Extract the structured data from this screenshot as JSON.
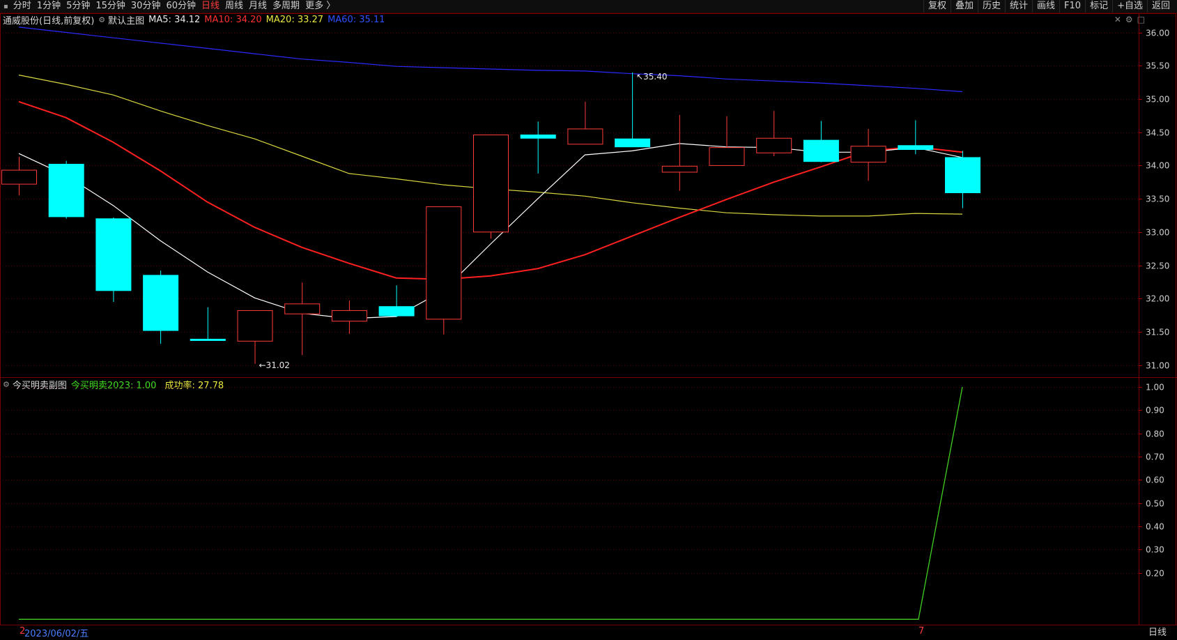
{
  "toolbar": {
    "left_items": [
      "分时",
      "1分钟",
      "5分钟",
      "15分钟",
      "30分钟",
      "60分钟",
      "日线",
      "周线",
      "月线",
      "多周期",
      "更多 〉"
    ],
    "active_item": "日线",
    "right_items": [
      "复权",
      "叠加",
      "历史",
      "统计",
      "画线",
      "F10",
      "标记",
      "+自选",
      "返回"
    ]
  },
  "main_legend": {
    "stock": "通威股份(日线,前复权)",
    "main_chart_name": "默认主图",
    "ma5": "MA5: 34.12",
    "ma10": "MA10: 34.20",
    "ma20": "MA20: 33.27",
    "ma60": "MA60: 35.11"
  },
  "sub_legend": {
    "name": "今买明卖副图",
    "indicator": "今买明卖2023: 1.00",
    "rate": "成功率: 27.78"
  },
  "footer": {
    "date_label": "2023/06/02/五",
    "left_marker": "2",
    "mid_marker": "7",
    "axis_button": "日线"
  },
  "colors": {
    "up": "#ff3b3b",
    "down": "#00ffff",
    "ma5": "#ffffff",
    "ma10": "#ff2020",
    "ma20": "#d8d840",
    "ma60": "#2a2aff",
    "indicator": "#40d020",
    "grid": "#7a0000",
    "axis_text": "#d0d0d0"
  },
  "chart_data": [
    {
      "type": "candlestick",
      "title": "通威股份(日线,前复权)",
      "ylim": [
        30.85,
        36.1
      ],
      "y_ticks": [
        31.0,
        31.5,
        32.0,
        32.5,
        33.0,
        33.5,
        34.0,
        34.5,
        35.0,
        35.5,
        36.0
      ],
      "candles": [
        {
          "open": 33.72,
          "close": 33.93,
          "high": 34.13,
          "low": 33.55
        },
        {
          "open": 34.02,
          "close": 33.23,
          "high": 34.07,
          "low": 33.2
        },
        {
          "open": 33.2,
          "close": 32.12,
          "high": 33.22,
          "low": 31.95
        },
        {
          "open": 32.35,
          "close": 31.52,
          "high": 32.42,
          "low": 31.32
        },
        {
          "open": 31.39,
          "close": 31.37,
          "high": 31.87,
          "low": 31.37
        },
        {
          "open": 31.36,
          "close": 31.82,
          "high": 31.82,
          "low": 31.02
        },
        {
          "open": 31.77,
          "close": 31.92,
          "high": 32.24,
          "low": 31.15
        },
        {
          "open": 31.66,
          "close": 31.82,
          "high": 31.97,
          "low": 31.47
        },
        {
          "open": 31.88,
          "close": 31.74,
          "high": 32.2,
          "low": 31.72
        },
        {
          "open": 31.69,
          "close": 33.38,
          "high": 33.38,
          "low": 31.46
        },
        {
          "open": 33.0,
          "close": 34.46,
          "high": 34.46,
          "low": 32.9
        },
        {
          "open": 34.46,
          "close": 34.41,
          "high": 34.66,
          "low": 33.88
        },
        {
          "open": 34.32,
          "close": 34.55,
          "high": 34.96,
          "low": 34.32
        },
        {
          "open": 34.4,
          "close": 34.28,
          "high": 35.4,
          "low": 34.28
        },
        {
          "open": 33.9,
          "close": 33.99,
          "high": 34.76,
          "low": 33.62
        },
        {
          "open": 34.0,
          "close": 34.27,
          "high": 34.74,
          "low": 34.0
        },
        {
          "open": 34.19,
          "close": 34.41,
          "high": 34.82,
          "low": 34.14
        },
        {
          "open": 34.38,
          "close": 34.06,
          "high": 34.67,
          "low": 34.05
        },
        {
          "open": 34.05,
          "close": 34.29,
          "high": 34.55,
          "low": 33.77
        },
        {
          "open": 34.3,
          "close": 34.24,
          "high": 34.68,
          "low": 34.17
        },
        {
          "open": 34.12,
          "close": 33.59,
          "high": 34.22,
          "low": 33.36
        }
      ],
      "ma5": [
        34.18,
        33.85,
        33.4,
        32.87,
        32.4,
        32.01,
        31.78,
        31.7,
        31.73,
        32.12,
        32.82,
        33.5,
        34.16,
        34.22,
        34.33,
        34.28,
        34.27,
        34.2,
        34.2,
        34.27,
        34.12
      ],
      "ma10": [
        34.96,
        34.72,
        34.35,
        33.92,
        33.45,
        33.07,
        32.77,
        32.53,
        32.31,
        32.29,
        32.34,
        32.45,
        32.66,
        32.94,
        33.22,
        33.49,
        33.75,
        33.98,
        34.22,
        34.28,
        34.2
      ],
      "ma20": [
        35.36,
        35.22,
        35.06,
        34.82,
        34.6,
        34.4,
        34.14,
        33.88,
        33.8,
        33.71,
        33.65,
        33.6,
        33.54,
        33.44,
        33.36,
        33.29,
        33.26,
        33.24,
        33.24,
        33.28,
        33.27
      ],
      "ma60": [
        36.08,
        36.0,
        35.92,
        35.84,
        35.76,
        35.68,
        35.6,
        35.55,
        35.49,
        35.47,
        35.45,
        35.43,
        35.42,
        35.38,
        35.35,
        35.3,
        35.27,
        35.24,
        35.2,
        35.16,
        35.11
      ],
      "annotations": [
        {
          "text": "35.40",
          "index": 13,
          "value": 35.4
        },
        {
          "text": "31.02",
          "index": 5,
          "value": 31.02
        }
      ]
    },
    {
      "type": "line",
      "title": "今买明卖副图",
      "ylim": [
        -0.02,
        1.03
      ],
      "y_ticks": [
        0.2,
        0.3,
        0.4,
        0.5,
        0.6,
        0.7,
        0.8,
        0.9,
        1.0
      ],
      "series": [
        {
          "name": "今买明卖2023",
          "values": [
            0,
            0,
            0,
            0,
            0,
            0,
            0,
            0,
            0,
            0,
            0,
            0,
            0,
            0,
            0,
            0,
            0,
            0,
            0,
            1,
            1
          ]
        }
      ],
      "plot_values": [
        0,
        0,
        0,
        0,
        0,
        0,
        0,
        0,
        0,
        0,
        0,
        0,
        0,
        0,
        0,
        0,
        0,
        0,
        0,
        0,
        1
      ]
    }
  ]
}
